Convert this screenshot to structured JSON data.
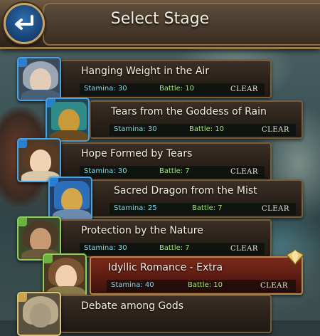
{
  "header": {
    "title": "Select Stage"
  },
  "stages": [
    {
      "name": "Hanging Weight in the Air",
      "stamina": "Stamina: 30",
      "battle": "Battle: 10",
      "status": "CLEAR",
      "element": "water"
    },
    {
      "name": "Tears from the Goddess of Rain",
      "stamina": "Stamina: 30",
      "battle": "Battle: 10",
      "status": "CLEAR",
      "element": "water"
    },
    {
      "name": "Hope Formed by Tears",
      "stamina": "Stamina: 30",
      "battle": "Battle: 7",
      "status": "CLEAR",
      "element": "water"
    },
    {
      "name": "Sacred Dragon from the Mist",
      "stamina": "Stamina: 25",
      "battle": "Battle: 7",
      "status": "CLEAR",
      "element": "water"
    },
    {
      "name": "Protection by the Nature",
      "stamina": "Stamina: 30",
      "battle": "Battle: 7",
      "status": "CLEAR",
      "element": "forest"
    },
    {
      "name": "Idyllic Romance - Extra",
      "stamina": "Stamina: 40",
      "battle": "Battle: 10",
      "status": "CLEAR",
      "element": "forest"
    },
    {
      "name": "Debate among Gods",
      "stamina": "",
      "battle": "",
      "status": "",
      "element": "earth"
    }
  ],
  "icons": {
    "back": "back-arrow-icon"
  },
  "colors": {
    "stamina": "#7fd6e6",
    "battle": "#9fe07a",
    "water_element": "#4ba3e0",
    "forest_element": "#8ccf5a"
  }
}
